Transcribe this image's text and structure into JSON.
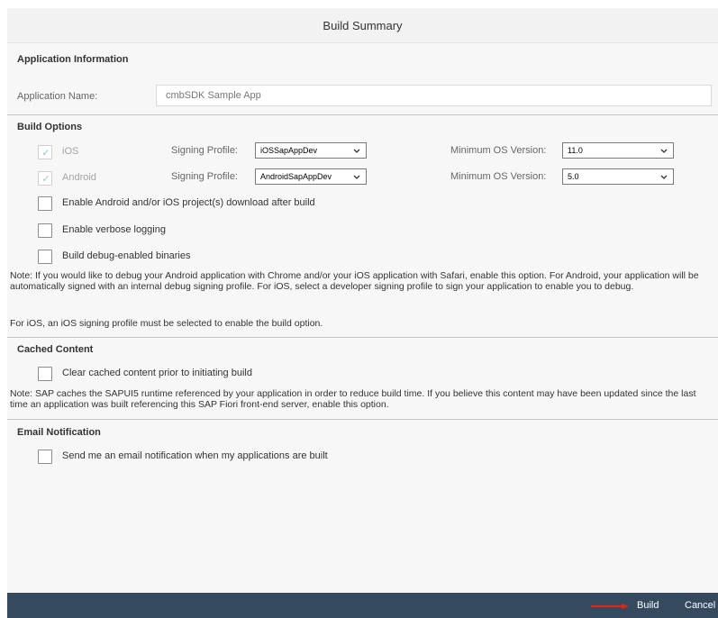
{
  "dialog": {
    "title": "Build Summary"
  },
  "application_info": {
    "section_title": "Application Information",
    "name_label": "Application Name:",
    "name_value": "cmbSDK Sample App"
  },
  "build_options": {
    "section_title": "Build Options",
    "ios": {
      "label": "iOS",
      "checked": true,
      "signing_label": "Signing Profile:",
      "signing_value": "iOSSapAppDev",
      "min_os_label": "Minimum OS Version:",
      "min_os_value": "11.0"
    },
    "android": {
      "label": "Android",
      "checked": true,
      "signing_label": "Signing Profile:",
      "signing_value": "AndroidSapAppDev",
      "min_os_label": "Minimum OS Version:",
      "min_os_value": "5.0"
    },
    "enable_download_label": "Enable Android and/or iOS project(s) download after build",
    "verbose_logging_label": "Enable verbose logging",
    "debug_binaries_label": "Build debug-enabled binaries",
    "debug_note": "Note: If you would like to debug your Android application with Chrome and/or your iOS application with Safari, enable this option. For Android, your application will be automatically signed with an internal debug signing profile. For iOS, select a developer signing profile to sign your application to enable you to debug.",
    "ios_note": "For iOS, an iOS signing profile must be selected to enable the build option."
  },
  "cached_content": {
    "section_title": "Cached Content",
    "clear_label": "Clear cached content prior to initiating build",
    "note": "Note: SAP caches the SAPUI5 runtime referenced by your application in order to reduce build time. If you believe this content may have been updated since the last time an application was built referencing this SAP Fiori front-end server, enable this option."
  },
  "email_notification": {
    "section_title": "Email Notification",
    "send_label": "Send me an email notification when my applications are built"
  },
  "footer": {
    "build_label": "Build",
    "cancel_label": "Cancel"
  },
  "colors": {
    "footer_bg": "#354a5f",
    "arrow": "#e0251b",
    "content_bg": "#f7f7f7"
  }
}
